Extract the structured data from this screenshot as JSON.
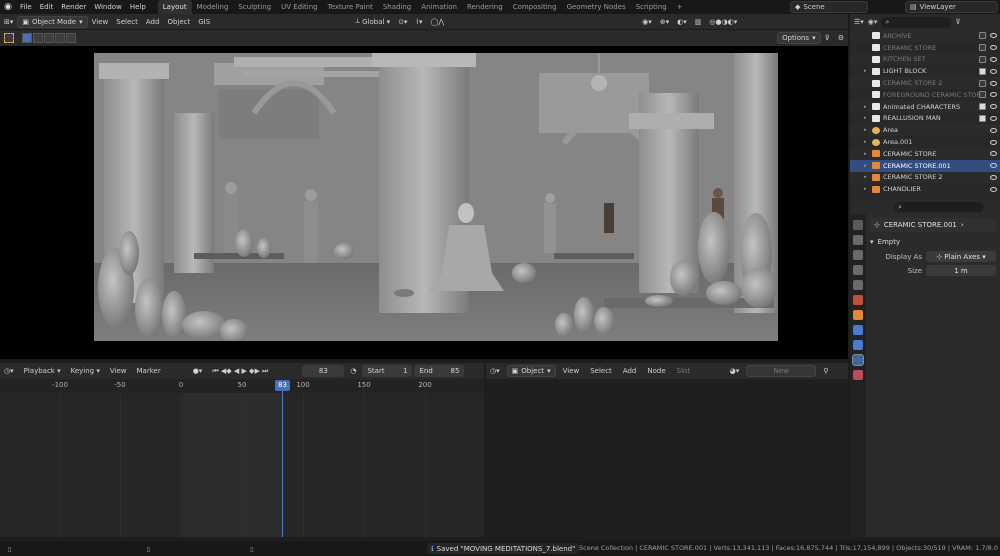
{
  "menubar": {
    "items": [
      "File",
      "Edit",
      "Render",
      "Window",
      "Help"
    ],
    "workspaces": [
      "Layout",
      "Modeling",
      "Sculpting",
      "UV Editing",
      "Texture Paint",
      "Shading",
      "Animation",
      "Rendering",
      "Compositing",
      "Geometry Nodes",
      "Scripting"
    ],
    "active_workspace": "Layout",
    "scene": "Scene",
    "view_layer": "ViewLayer"
  },
  "viewport_header": {
    "mode": "Object Mode",
    "menus": [
      "View",
      "Select",
      "Add",
      "Object",
      "GIS"
    ],
    "transform_orientation": "Global",
    "options_label": "Options"
  },
  "timeline": {
    "menus": [
      "Playback",
      "Keying",
      "View",
      "Marker"
    ],
    "current_frame": "83",
    "start_label": "Start",
    "start": "1",
    "end_label": "End",
    "end": "85",
    "ruler_ticks": [
      "-100",
      "-50",
      "0",
      "50",
      "100",
      "150",
      "200"
    ]
  },
  "shader_editor": {
    "object_dropdown": "Object",
    "menus": [
      "View",
      "Select",
      "Add",
      "Node"
    ],
    "slot": "Slot",
    "new_label": "New"
  },
  "outliner": {
    "rows": [
      {
        "label": "ARCHIVE",
        "dim": true,
        "type": "collection",
        "checked": false
      },
      {
        "label": "CERAMIC STORE",
        "dim": true,
        "type": "collection",
        "checked": false
      },
      {
        "label": "KITCHEN SET",
        "dim": true,
        "type": "collection",
        "checked": false
      },
      {
        "label": "LIGHT BLOCK",
        "dim": false,
        "type": "collection",
        "checked": true
      },
      {
        "label": "CERAMIC STORE 2",
        "dim": true,
        "type": "collection",
        "checked": false
      },
      {
        "label": "FOREGROUND CERAMIC STORE",
        "dim": true,
        "type": "collection",
        "checked": false
      },
      {
        "label": "Animated CHARACTERS",
        "dim": false,
        "type": "collection",
        "checked": true
      },
      {
        "label": "REALLUSION MAN",
        "dim": false,
        "type": "collection",
        "checked": true
      },
      {
        "label": "Area",
        "dim": false,
        "type": "light",
        "checked": false
      },
      {
        "label": "Area.001",
        "dim": false,
        "type": "light",
        "checked": false
      },
      {
        "label": "CERAMIC STORE",
        "dim": false,
        "type": "object",
        "checked": false
      },
      {
        "label": "CERAMIC STORE.001",
        "dim": false,
        "type": "object",
        "checked": false,
        "selected": true
      },
      {
        "label": "CERAMIC STORE 2",
        "dim": false,
        "type": "object",
        "checked": false
      },
      {
        "label": "CHANDLIER",
        "dim": false,
        "type": "object",
        "checked": false
      }
    ]
  },
  "properties": {
    "object_name": "CERAMIC STORE.001",
    "panel_title": "Empty",
    "display_as_label": "Display As",
    "display_as_value": "Plain Axes",
    "size_label": "Size",
    "size_value": "1 m"
  },
  "status": {
    "saved_message": "Saved \"MOVING MEDITATIONS_7.blend\"",
    "stats": "Scene Collection | CERAMIC STORE.001 | Verts:13,341,113 | Faces:16,875,744 | Tris:17,154,899 | Objects:30/519 | VRAM: 1.7/8.0"
  },
  "colors": {
    "accent": "#4772b3",
    "selection_row": "#334d80",
    "object_icon": "#e0893a"
  }
}
